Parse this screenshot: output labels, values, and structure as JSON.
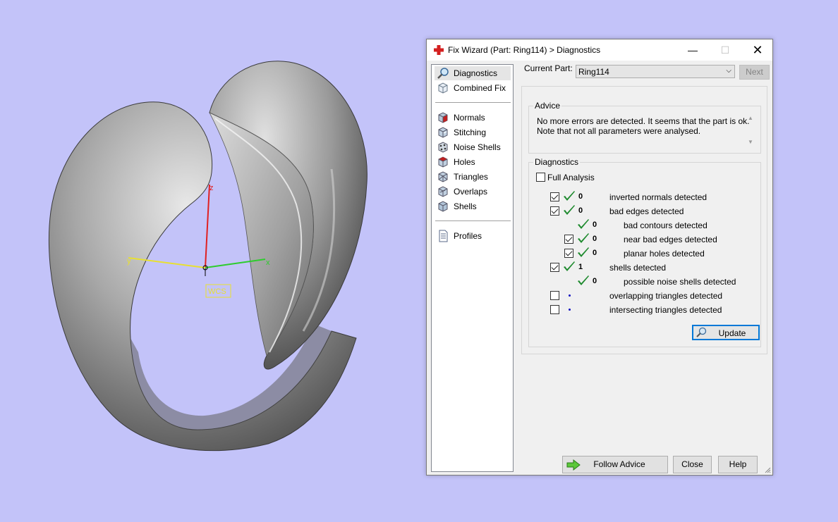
{
  "viewport": {
    "axis_labels": {
      "x": "x",
      "y": "y",
      "z": "z"
    },
    "wcs_label": "WCS",
    "axis_colors": {
      "x": "#2ecc2e",
      "y": "#e8e030",
      "z": "#e02020"
    }
  },
  "window": {
    "title": "Fix Wizard (Part: Ring114) > Diagnostics",
    "controls": {
      "minimize": "—",
      "maximize": "☐",
      "close": "✕"
    }
  },
  "nav": {
    "group1": [
      {
        "label": "Diagnostics",
        "icon": "magnifier-icon",
        "selected": true
      },
      {
        "label": "Combined Fix",
        "icon": "cube-outline-icon"
      }
    ],
    "group2": [
      {
        "label": "Normals",
        "icon": "normals-cube-icon"
      },
      {
        "label": "Stitching",
        "icon": "stitching-cube-icon"
      },
      {
        "label": "Noise Shells",
        "icon": "noise-shells-icon"
      },
      {
        "label": "Holes",
        "icon": "holes-cube-icon"
      },
      {
        "label": "Triangles",
        "icon": "triangles-cube-icon"
      },
      {
        "label": "Overlaps",
        "icon": "overlaps-cube-icon"
      },
      {
        "label": "Shells",
        "icon": "shells-cube-icon"
      }
    ],
    "group3": [
      {
        "label": "Profiles",
        "icon": "document-icon"
      }
    ]
  },
  "current_part": {
    "label": "Current Part:",
    "value": "Ring114",
    "next_label": "Next"
  },
  "advice": {
    "legend": "Advice",
    "line1": "No more errors are detected. It seems that the part is ok.",
    "line2": "Note that not all parameters were analysed."
  },
  "diagnostics": {
    "legend": "Diagnostics",
    "full_analysis_label": "Full Analysis",
    "full_analysis_checked": false,
    "rows": [
      {
        "checkbox": true,
        "checked": true,
        "status": "ok",
        "count": "0",
        "label": "inverted normals detected",
        "indent": 0
      },
      {
        "checkbox": true,
        "checked": true,
        "status": "ok",
        "count": "0",
        "label": "bad edges detected",
        "indent": 0
      },
      {
        "checkbox": false,
        "checked": false,
        "status": "ok",
        "count": "0",
        "label": "bad contours detected",
        "indent": 1
      },
      {
        "checkbox": true,
        "checked": true,
        "status": "ok",
        "count": "0",
        "label": "near bad edges detected",
        "indent": 1
      },
      {
        "checkbox": true,
        "checked": true,
        "status": "ok",
        "count": "0",
        "label": "planar holes detected",
        "indent": 1
      },
      {
        "checkbox": true,
        "checked": true,
        "status": "ok",
        "count": "1",
        "label": "shells detected",
        "indent": 0
      },
      {
        "checkbox": false,
        "checked": false,
        "status": "ok",
        "count": "0",
        "label": "possible noise shells detected",
        "indent": 1
      },
      {
        "checkbox": true,
        "checked": false,
        "status": "pending",
        "count": "",
        "label": "overlapping triangles detected",
        "indent": 0
      },
      {
        "checkbox": true,
        "checked": false,
        "status": "pending",
        "count": "",
        "label": "intersecting triangles detected",
        "indent": 0
      }
    ],
    "update_label": "Update"
  },
  "footer": {
    "follow_advice_label": "Follow Advice",
    "close_label": "Close",
    "help_label": "Help"
  },
  "colors": {
    "background": "#c3c3f9",
    "check_green": "#1e8a2e",
    "accent_blue": "#0078d7",
    "app_icon_red": "#d42020"
  }
}
